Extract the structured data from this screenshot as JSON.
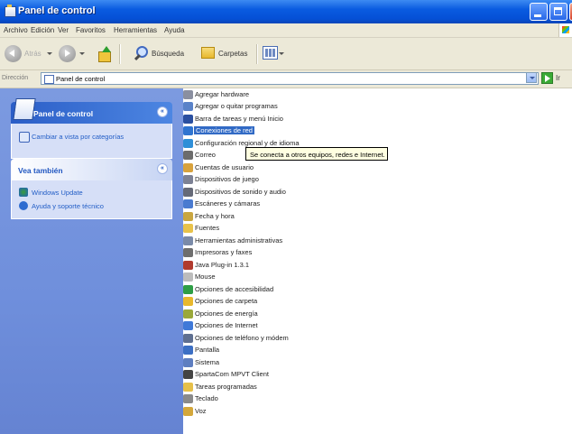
{
  "window": {
    "title": "Panel de control"
  },
  "menu": [
    "Archivo",
    "Edición",
    "Ver",
    "Favoritos",
    "Herramientas",
    "Ayuda"
  ],
  "toolbar": {
    "back": "Atrás",
    "search": "Búsqueda",
    "folders": "Carpetas"
  },
  "address": {
    "label": "Dirección",
    "value": "Panel de control",
    "go": "Ir"
  },
  "sidebar": {
    "control_panel": {
      "title": "Panel de control",
      "task": "Cambiar a vista por categorías"
    },
    "see_also": {
      "title": "Vea también",
      "items": [
        "Windows Update",
        "Ayuda y soporte técnico"
      ]
    }
  },
  "items": [
    {
      "label": "Agregar hardware",
      "color": "#8a8fa0"
    },
    {
      "label": "Agregar o quitar programas",
      "color": "#5a82c8"
    },
    {
      "label": "Barra de tareas y menú Inicio",
      "color": "#2a4fa0"
    },
    {
      "label": "Conexiones de red",
      "color": "#2f74d0"
    },
    {
      "label": "Configuración regional y de idioma",
      "color": "#2f8fd8"
    },
    {
      "label": "Correo",
      "color": "#6c6c6c"
    },
    {
      "label": "Cuentas de usuario",
      "color": "#d8a23c"
    },
    {
      "label": "Dispositivos de juego",
      "color": "#7c8194"
    },
    {
      "label": "Dispositivos de sonido y audio",
      "color": "#666a78"
    },
    {
      "label": "Escáneres y cámaras",
      "color": "#4a7bd0"
    },
    {
      "label": "Fecha y hora",
      "color": "#c9a640"
    },
    {
      "label": "Fuentes",
      "color": "#e8c24a"
    },
    {
      "label": "Herramientas administrativas",
      "color": "#7a8aa8"
    },
    {
      "label": "Impresoras y faxes",
      "color": "#6e6e6e"
    },
    {
      "label": "Java Plug-in 1.3.1",
      "color": "#b03a2e"
    },
    {
      "label": "Mouse",
      "color": "#bcbcbc"
    },
    {
      "label": "Opciones de accesibilidad",
      "color": "#2e9e45"
    },
    {
      "label": "Opciones de carpeta",
      "color": "#e8b82d"
    },
    {
      "label": "Opciones de energía",
      "color": "#9aa83a"
    },
    {
      "label": "Opciones de Internet",
      "color": "#3f79d8"
    },
    {
      "label": "Opciones de teléfono y módem",
      "color": "#5f6f90"
    },
    {
      "label": "Pantalla",
      "color": "#3c6fc4"
    },
    {
      "label": "Sistema",
      "color": "#5e7ec0"
    },
    {
      "label": "SpartaCom MPVT Client",
      "color": "#444444"
    },
    {
      "label": "Tareas programadas",
      "color": "#e6c04a"
    },
    {
      "label": "Teclado",
      "color": "#8a8a8a"
    },
    {
      "label": "Voz",
      "color": "#d4a73a"
    }
  ],
  "tooltip": "Se conecta a otros equipos, redes e Internet."
}
